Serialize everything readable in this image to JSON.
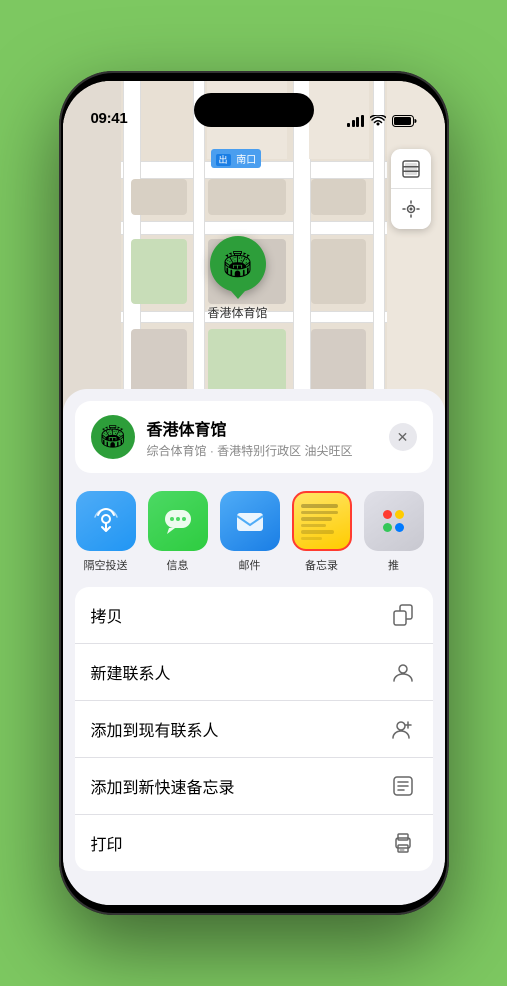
{
  "statusBar": {
    "time": "09:41",
    "locationArrow": "▶"
  },
  "map": {
    "label": "南口",
    "labelPrefix": "出"
  },
  "venuePin": {
    "label": "香港体育馆",
    "emoji": "🏟"
  },
  "venueCard": {
    "name": "香港体育馆",
    "description": "综合体育馆 · 香港特别行政区 油尖旺区",
    "emoji": "🏟"
  },
  "shareApps": [
    {
      "label": "隔空投送",
      "type": "airdrop"
    },
    {
      "label": "信息",
      "type": "messages"
    },
    {
      "label": "邮件",
      "type": "mail"
    },
    {
      "label": "备忘录",
      "type": "notes"
    },
    {
      "label": "推",
      "type": "more"
    }
  ],
  "actions": [
    {
      "label": "拷贝",
      "icon": "copy"
    },
    {
      "label": "新建联系人",
      "icon": "contact"
    },
    {
      "label": "添加到现有联系人",
      "icon": "add-contact"
    },
    {
      "label": "添加到新快速备忘录",
      "icon": "note-quick"
    },
    {
      "label": "打印",
      "icon": "print"
    }
  ]
}
